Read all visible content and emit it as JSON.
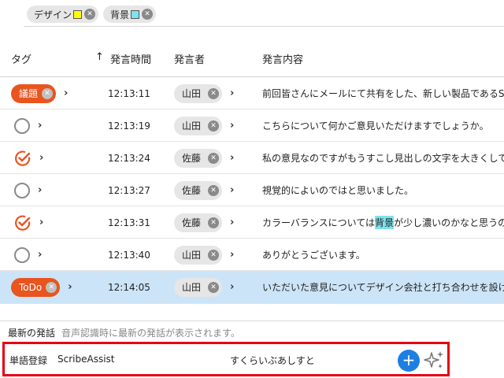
{
  "filters": [
    {
      "label": "デザイン",
      "swatch": "#ffff00"
    },
    {
      "label": "背景",
      "swatch": "#7fe3ee"
    }
  ],
  "columns": {
    "tag": "タグ",
    "time": "発言時間",
    "speaker": "発言者",
    "content": "発言内容",
    "sort_icon": "↑"
  },
  "rows": [
    {
      "tag_type": "pill",
      "tag_label": "議題",
      "time": "12:13:11",
      "speaker": "山田",
      "content": "前回皆さんにメールにて共有をした、新しい製品であるScrib"
    },
    {
      "tag_type": "empty",
      "time": "12:13:19",
      "speaker": "山田",
      "content": "こちらについて何かご意見いただけますでしょうか。"
    },
    {
      "tag_type": "check",
      "time": "12:13:24",
      "speaker": "佐藤",
      "content": "私の意見なのですがもうすこし見出しの文字を大きくしても"
    },
    {
      "tag_type": "empty",
      "time": "12:13:27",
      "speaker": "佐藤",
      "content": "視覚的によいのではと思いました。"
    },
    {
      "tag_type": "check",
      "time": "12:13:31",
      "speaker": "佐藤",
      "content_before": "カラーバランスについては",
      "content_highlight": "背景",
      "content_after": "が少し濃いのかなと思うので、"
    },
    {
      "tag_type": "empty",
      "time": "12:13:40",
      "speaker": "山田",
      "content": "ありがとうございます。"
    },
    {
      "tag_type": "pill",
      "tag_label": "ToDo",
      "time": "12:14:05",
      "speaker": "山田",
      "content": "いただいた意見についてデザイン会社と打ち合わせを設けて、",
      "selected": true
    }
  ],
  "latest": {
    "title": "最新の発話",
    "hint": "音声認識時に最新の発話が表示されます。"
  },
  "register": {
    "label": "単語登録",
    "word": "ScribeAssist",
    "reading": "すくらいぶあしすと",
    "add": "+"
  },
  "colors": {
    "accent": "#e9541f",
    "selected_row": "#cce4f7",
    "highlight": "#7fe3ee",
    "add_button": "#1e7fe0",
    "frame": "#e60012"
  }
}
